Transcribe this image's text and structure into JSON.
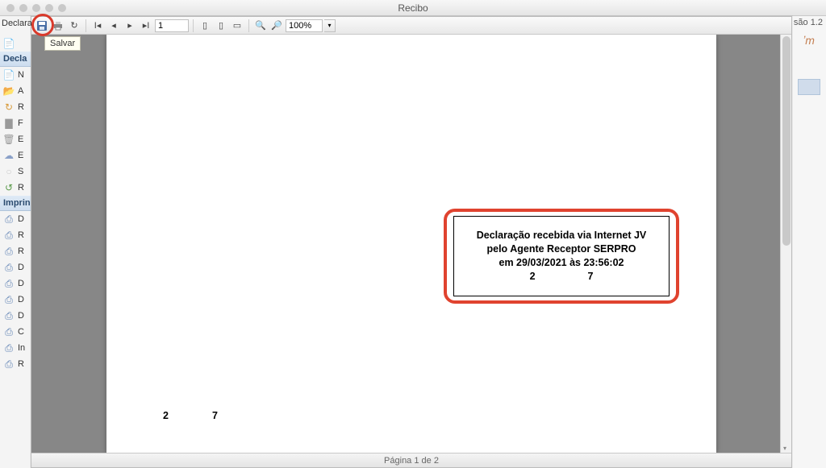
{
  "window": {
    "title": "Recibo"
  },
  "app": {
    "version_label": "são 1.2"
  },
  "sidebar": {
    "top_label": "Declara",
    "group1_header": "Decla",
    "group1_items": [
      "N",
      "A",
      "R",
      "F",
      "E",
      "E",
      "S",
      "R"
    ],
    "group2_header": "Imprin",
    "group2_items": [
      "D",
      "R",
      "R",
      "D",
      "D",
      "D",
      "D",
      "C",
      "In",
      "R"
    ]
  },
  "toolbar": {
    "save_tooltip": "Salvar",
    "page_value": "1",
    "zoom_text": "100%"
  },
  "receipt": {
    "line1": "Declaração recebida via Internet JV",
    "line2": "pelo Agente Receptor SERPRO",
    "line3": "em 29/03/2021 às 23:56:02",
    "code_a": "2",
    "code_b": "7"
  },
  "page_footer_numbers": {
    "a": "2",
    "b": "7"
  },
  "status": {
    "text": "Página 1 de 2"
  }
}
